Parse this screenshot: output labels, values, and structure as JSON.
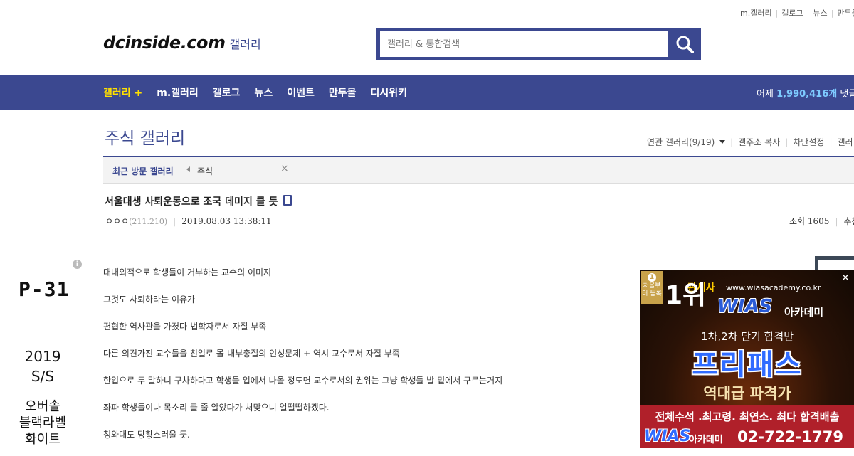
{
  "util_links": [
    "m.갤러리",
    "갤로그",
    "뉴스",
    "만두몰"
  ],
  "logo": {
    "brand": "dcinside.com",
    "section": "갤러리"
  },
  "search": {
    "placeholder": "갤러리 & 통합검색",
    "icon": "search-icon"
  },
  "nav": {
    "items": [
      {
        "label": "갤러리 +",
        "active": true
      },
      {
        "label": "m.갤러리",
        "active": false
      },
      {
        "label": "갤로그",
        "active": false
      },
      {
        "label": "뉴스",
        "active": false
      },
      {
        "label": "이벤트",
        "active": false
      },
      {
        "label": "만두몰",
        "active": false
      },
      {
        "label": "디시위키",
        "active": false
      }
    ],
    "stat_prefix": "어제",
    "stat_value": "1,990,416개",
    "stat_suffix": "댓글"
  },
  "gallery": {
    "title": "주식 갤러리",
    "tools": [
      "연관 갤러리(9/19)",
      "갤주소 복사",
      "차단설정",
      "갤러"
    ]
  },
  "recent": {
    "label": "최근 방문 갤러리",
    "item": "주식"
  },
  "post": {
    "title": "서울대생 사퇴운동으로 조국 데미지 클 듯",
    "author": "ㅇㅇㅇ",
    "ip": "(211.210)",
    "date": "2019.08.03 13:38:11",
    "views_label": "조회 1605",
    "recommend_label": "추천",
    "paragraphs": [
      "대내외적으로 학생들이 거부하는 교수의 이미지",
      "그것도 사퇴하라는 이유가",
      "편협한 역사관을 가졌다-법학자로서 자질 부족",
      "다른 의견가진 교수들을 친일로 몰-내부총질의 인성문제 + 역시 교수로서 자질 부족",
      "한입으로 두 말하니 구차하다고 학생들 입에서 나올 정도면 교수로서의 권위는 그냥 학생들 발 밑에서 구르는거지",
      "좌파 학생들이나 목소리 클 줄 알았다가 처맞으니 얼떨떨하겠다.",
      "청와대도 당황스러울 듯."
    ]
  },
  "left_ad": {
    "code": "P-31",
    "season_1": "2019",
    "season_2": "S/S",
    "name_1": "오버솔",
    "name_2": "블랙라벨",
    "name_3": "화이트"
  },
  "right_ad": {
    "badge": "처음부터 등록",
    "rank": "1위",
    "customs": "관세사",
    "url": "www.wiasacademy.co.kr",
    "brand": "WIAS",
    "academy": "아카데미",
    "pass": "1차,2차 단기 합격반",
    "course": "프리패스",
    "record": "역대급 파격가",
    "line1": "전체수석 .최고령. 최연소. 최다 합격배출",
    "phone": "02-722-1779"
  },
  "colors": {
    "brand_blue": "#3b4890",
    "nav_active": "#ffe000",
    "stat_value": "#7ecbff",
    "ad_red": "#b0202a"
  }
}
